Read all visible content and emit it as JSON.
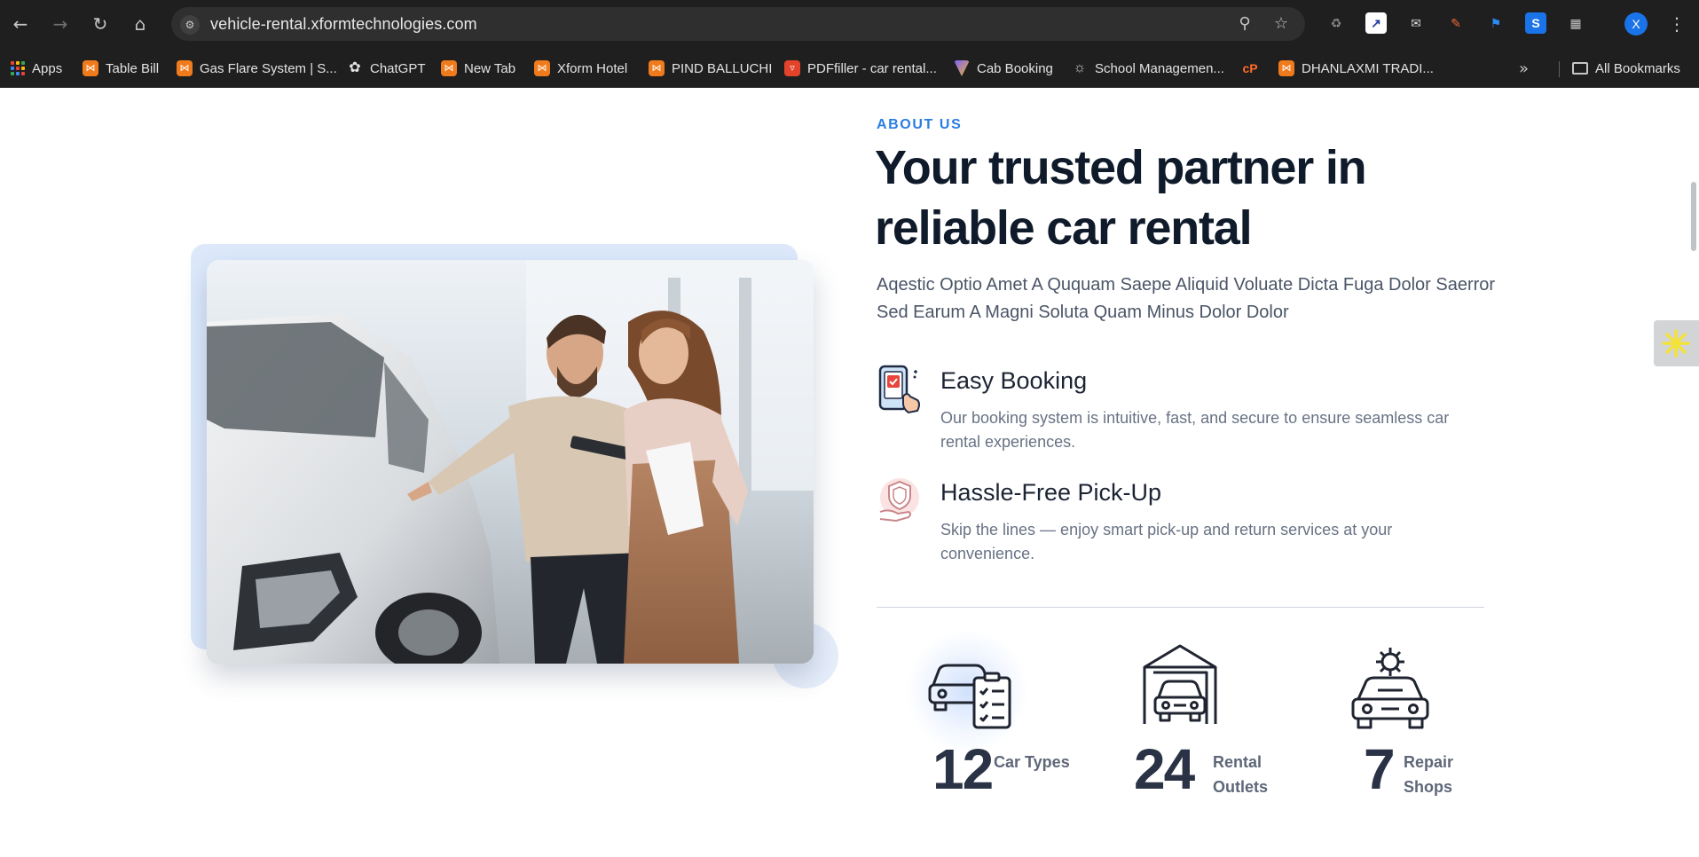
{
  "browser": {
    "url": "vehicle-rental.xformtechnologies.com",
    "profile_initial": "X",
    "bookmarks": [
      {
        "label": "Apps",
        "icon": "apps-grid-icon"
      },
      {
        "label": "Table Bill",
        "icon": "xampp-icon"
      },
      {
        "label": "Gas Flare System | S...",
        "icon": "xampp-icon"
      },
      {
        "label": "ChatGPT",
        "icon": "chatgpt-icon"
      },
      {
        "label": "New Tab",
        "icon": "xampp-icon"
      },
      {
        "label": "Xform Hotel",
        "icon": "xampp-icon"
      },
      {
        "label": "PIND BALLUCHI",
        "icon": "xampp-icon"
      },
      {
        "label": "PDFfiller - car rental...",
        "icon": "pdffiller-icon"
      },
      {
        "label": "Cab Booking",
        "icon": "vite-icon"
      },
      {
        "label": "School Managemen...",
        "icon": "globe-icon"
      },
      {
        "label": "",
        "icon": "cpanel-icon"
      },
      {
        "label": "DHANLAXMI TRADI...",
        "icon": "xampp-icon"
      }
    ],
    "all_bookmarks_label": "All Bookmarks"
  },
  "about": {
    "eyebrow": "ABOUT US",
    "headline": "Your trusted partner in reliable car rental",
    "lead": "Aqestic Optio Amet A Ququam Saepe Aliquid Voluate Dicta Fuga Dolor Saerror Sed Earum A Magni Soluta Quam Minus Dolor Dolor",
    "features": [
      {
        "title": "Easy Booking",
        "description": "Our booking system is intuitive, fast, and secure to ensure seamless car rental experiences.",
        "icon": "phone-booking-icon"
      },
      {
        "title": "Hassle-Free Pick-Up",
        "description": "Skip the lines — enjoy smart pick-up and return services at your convenience.",
        "icon": "hand-shield-icon"
      }
    ],
    "stats": [
      {
        "number": "12",
        "label": "Car Types",
        "icon": "car-checklist-icon"
      },
      {
        "number": "24",
        "label": "Rental Outlets",
        "icon": "car-garage-icon"
      },
      {
        "number": "7",
        "label": "Repair Shops",
        "icon": "car-repair-icon"
      }
    ]
  },
  "colors": {
    "accent": "#2a7de1",
    "heading": "#0f1a2a",
    "image_backdrop": "#dde9fb"
  }
}
